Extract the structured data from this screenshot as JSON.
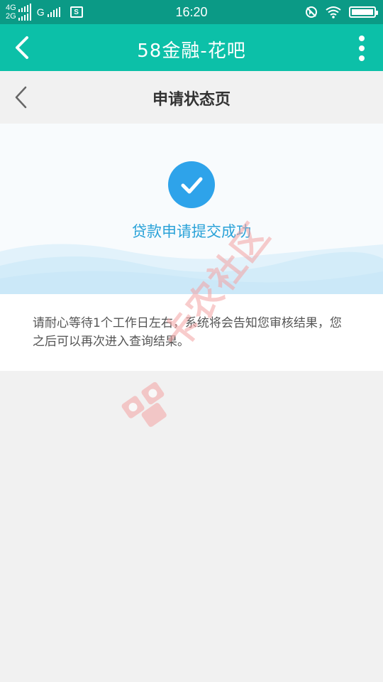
{
  "status_bar": {
    "net1": "4G",
    "net2": "2G",
    "net3": "G",
    "sim_icon": "S",
    "time": "16:20",
    "icons": [
      "mute-icon",
      "wifi-icon",
      "battery-icon"
    ]
  },
  "app_bar": {
    "title": "58金融-花吧",
    "back_icon": "chevron-left-icon",
    "more_icon": "more-vertical-icon"
  },
  "page_header": {
    "title": "申请状态页",
    "back_icon": "chevron-left-icon"
  },
  "result": {
    "icon": "check-circle-icon",
    "message": "贷款申请提交成功"
  },
  "info": {
    "text": "请耐心等待1个工作日左右，系统将会告知您审核结果，您之后可以再次进入查询结果。"
  },
  "watermark": {
    "text": "卡农社区"
  },
  "colors": {
    "status_bar": "#0b9a86",
    "app_bar": "#0cc0a8",
    "accent": "#2ea3ea",
    "success_text": "#2aa2d8",
    "background": "#f1f1f1"
  }
}
